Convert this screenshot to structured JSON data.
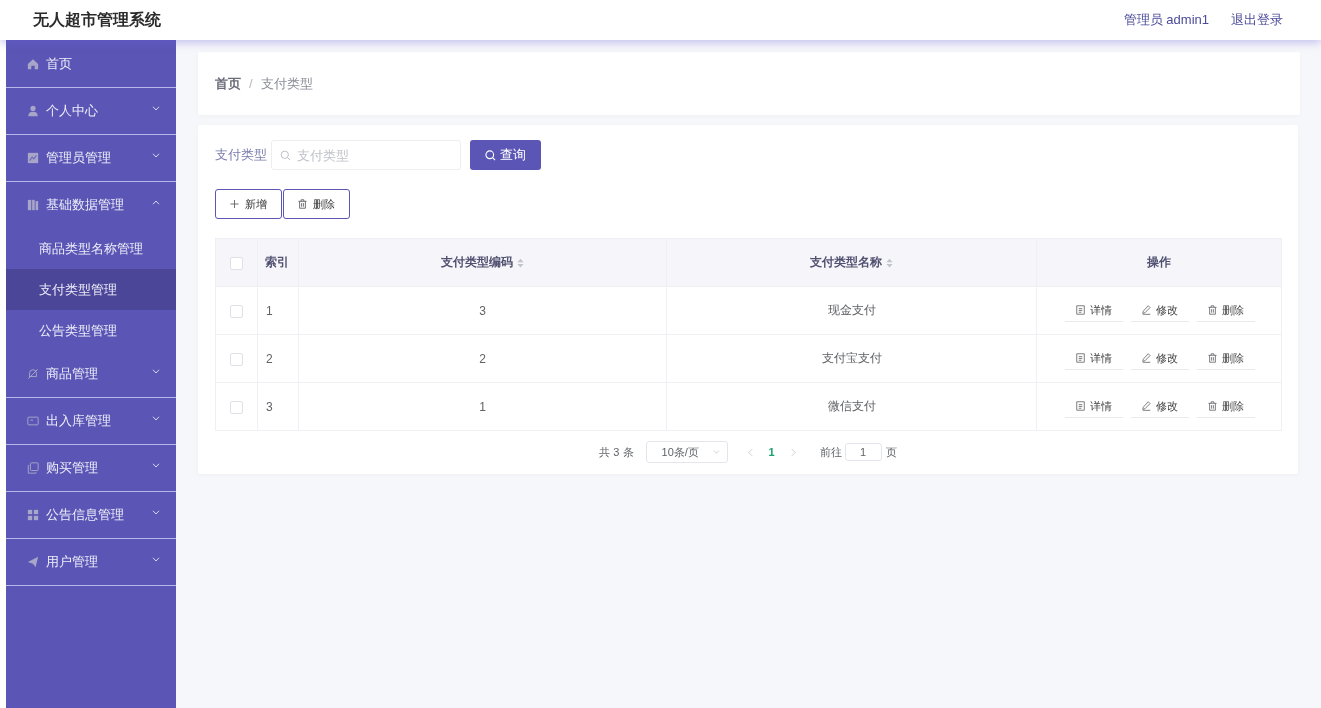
{
  "header": {
    "title": "无人超市管理系统",
    "user": "管理员 admin1",
    "logout": "退出登录"
  },
  "sidebar": {
    "items": [
      {
        "label": "首页",
        "kind": "link",
        "selected": false
      },
      {
        "label": "个人中心",
        "kind": "group",
        "selected": false,
        "expanded": false
      },
      {
        "label": "管理员管理",
        "kind": "group",
        "selected": false,
        "expanded": false
      },
      {
        "label": "基础数据管理",
        "kind": "group",
        "selected": false,
        "expanded": true,
        "children": [
          {
            "label": "商品类型名称管理",
            "selected": false
          },
          {
            "label": "支付类型管理",
            "selected": true
          },
          {
            "label": "公告类型管理",
            "selected": false
          }
        ]
      },
      {
        "label": "商品管理",
        "kind": "group",
        "selected": false,
        "expanded": false
      },
      {
        "label": "出入库管理",
        "kind": "group",
        "selected": false,
        "expanded": false
      },
      {
        "label": "购买管理",
        "kind": "group",
        "selected": false,
        "expanded": false
      },
      {
        "label": "公告信息管理",
        "kind": "group",
        "selected": false,
        "expanded": false
      },
      {
        "label": "用户管理",
        "kind": "group",
        "selected": false,
        "expanded": false
      }
    ]
  },
  "breadcrumb": {
    "items": [
      "首页",
      "支付类型"
    ],
    "separator": "/"
  },
  "search": {
    "label": "支付类型",
    "placeholder": "支付类型",
    "button": "查询"
  },
  "toolbar": [
    {
      "label": "新增",
      "kind": "add"
    },
    {
      "label": "删除",
      "kind": "delete"
    }
  ],
  "table": {
    "select_all": {
      "checked": false
    },
    "columns": [
      {
        "label": "索引",
        "sortable": false
      },
      {
        "label": "支付类型编码",
        "sortable": true
      },
      {
        "label": "支付类型名称",
        "sortable": true
      },
      {
        "label": "操作",
        "sortable": false
      }
    ],
    "rows": [
      {
        "checked": false,
        "cells": [
          "1",
          "3",
          "现金支付"
        ],
        "actions": [
          {
            "label": "详情",
            "kind": "detail"
          },
          {
            "label": "修改",
            "kind": "edit"
          },
          {
            "label": "删除",
            "kind": "delete"
          }
        ]
      },
      {
        "checked": false,
        "cells": [
          "2",
          "2",
          "支付宝支付"
        ],
        "actions": [
          {
            "label": "详情",
            "kind": "detail"
          },
          {
            "label": "修改",
            "kind": "edit"
          },
          {
            "label": "删除",
            "kind": "delete"
          }
        ]
      },
      {
        "checked": false,
        "cells": [
          "3",
          "1",
          "微信支付"
        ],
        "actions": [
          {
            "label": "详情",
            "kind": "detail"
          },
          {
            "label": "修改",
            "kind": "edit"
          },
          {
            "label": "删除",
            "kind": "delete"
          }
        ]
      }
    ]
  },
  "pagination": {
    "total": "共 3 条",
    "page_size": "10条/页",
    "pages": [
      {
        "label": "1",
        "selected": true
      }
    ],
    "goto": {
      "label": "前往",
      "value": "1",
      "suffix": "页"
    }
  }
}
